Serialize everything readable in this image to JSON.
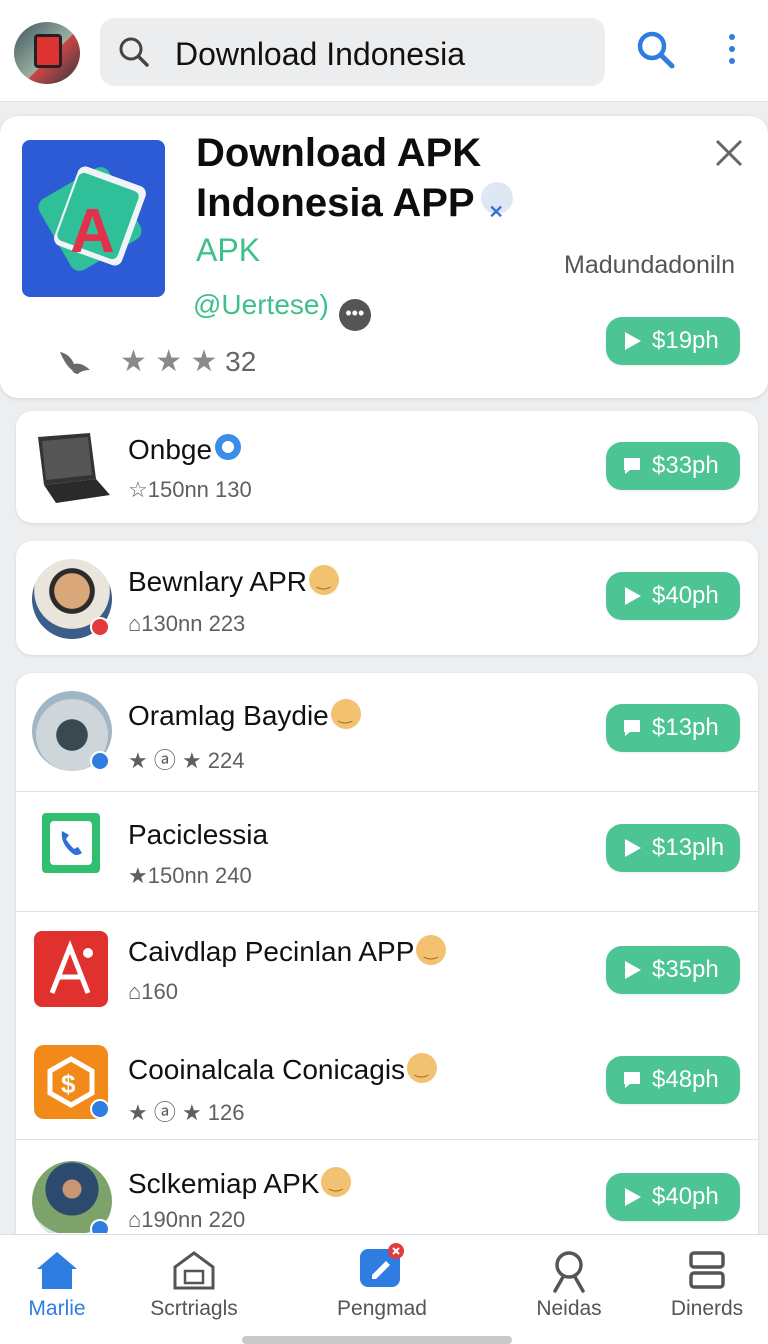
{
  "search": {
    "query": "Download Indonesia"
  },
  "featured": {
    "title_line1": "Download APK",
    "title_line2": "Indonesia APP",
    "type": "APK",
    "developer": "Madundadoniln",
    "handle": "@Uertese)",
    "rating": "32",
    "price": "$19ph"
  },
  "apps": [
    {
      "name": "Onbge",
      "meta": "150nn 130",
      "price": "$33ph",
      "button_icon": "chat-icon"
    },
    {
      "name": "Bewnlary APR",
      "meta": "130nn 223",
      "price": "$40ph",
      "button_icon": "play-icon"
    },
    {
      "name": "Oramlag Baydie",
      "meta_rating": "224",
      "price": "$13ph",
      "button_icon": "chat-icon"
    },
    {
      "name": "Paciclessia",
      "meta": "150nn 240",
      "price": "$13plh",
      "button_icon": "play-icon"
    },
    {
      "name": "Caivdlap Pecinlan APP",
      "meta": "160",
      "price": "$35ph",
      "button_icon": "play-icon"
    },
    {
      "name": "Cooinalcala Conicagis",
      "meta_rating": "126",
      "price": "$48ph",
      "button_icon": "chat-icon"
    },
    {
      "name": "Sclkemiap APK",
      "meta": "190nn 220",
      "price": "$40ph",
      "button_icon": "play-icon"
    }
  ],
  "nav": [
    {
      "label": "Marlie",
      "icon": "home-icon",
      "active": true
    },
    {
      "label": "Scrtriagls",
      "icon": "store-icon"
    },
    {
      "label": "Pengmad",
      "icon": "edit-icon"
    },
    {
      "label": "Neidas",
      "icon": "person-icon"
    },
    {
      "label": "Dinerds",
      "icon": "list-icon"
    }
  ],
  "colors": {
    "accent": "#2f7de1",
    "price_green": "#4cc493",
    "apk_green": "#3fbf8a"
  }
}
